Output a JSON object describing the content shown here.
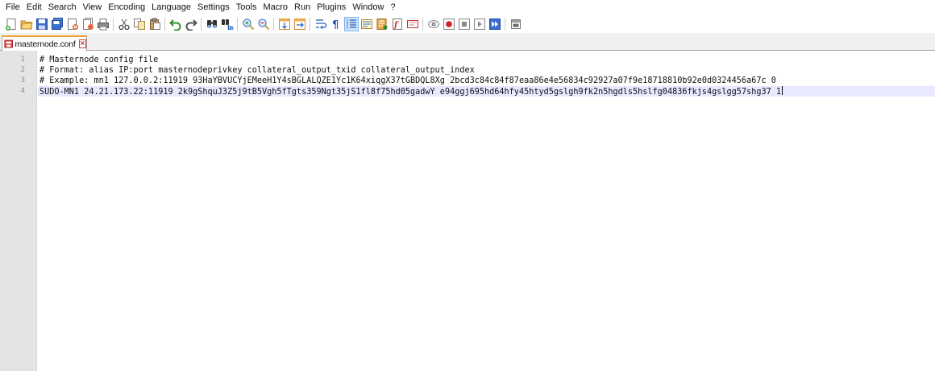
{
  "menu": [
    "File",
    "Edit",
    "Search",
    "View",
    "Encoding",
    "Language",
    "Settings",
    "Tools",
    "Macro",
    "Run",
    "Plugins",
    "Window",
    "?"
  ],
  "toolbar": {
    "groups": [
      [
        "new-file",
        "open-file",
        "save",
        "save-all",
        "close",
        "close-all",
        "print"
      ],
      [
        "cut",
        "copy",
        "paste"
      ],
      [
        "undo",
        "redo"
      ],
      [
        "find",
        "replace"
      ],
      [
        "zoom-in",
        "zoom-out"
      ],
      [
        "sync-vertical",
        "sync-horizontal"
      ],
      [
        "word-wrap",
        "show-all-characters",
        "indent-guide",
        "user-defined-language",
        "document-map",
        "function-list",
        "monitoring"
      ],
      [
        "record-macro",
        "stop-recording",
        "playback-macro",
        "run-macro-multiple",
        "save-macro"
      ],
      [
        "panel-toggle"
      ]
    ],
    "active": "indent-guide"
  },
  "tab": {
    "label": "masternode.conf"
  },
  "editor": {
    "lines": [
      {
        "num": "1",
        "text": "# Masternode config file"
      },
      {
        "num": "2",
        "text": "# Format: alias IP:port masternodeprivkey collateral_output_txid collateral_output_index"
      },
      {
        "num": "3",
        "text": "# Example: mn1 127.0.0.2:11919 93HaYBVUCYjEMeeH1Y4sBGLALQZE1Yc1K64xiqgX37tGBDQL8Xg 2bcd3c84c84f87eaa86e4e56834c92927a07f9e18718810b92e0d0324456a67c 0"
      },
      {
        "num": "4",
        "text": "SUDO-MN1 24.21.173.22:11919 2k9gShquJ3Z5j9tB5Vgh5fTgts359Ngt35jS1fl8f75hd05gadwY e94ggj695hd64hfy45htyd5gslgh9fk2n5hgdls5hslfg04836fkjs4gslgg57shg37 1",
        "current": true
      }
    ]
  }
}
